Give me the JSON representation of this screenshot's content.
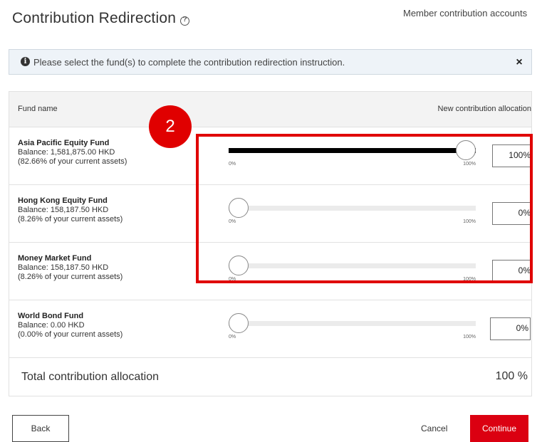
{
  "header": {
    "title": "Contribution Redirection",
    "top_link": "Member contribution accounts"
  },
  "notice": {
    "icon_glyph": "i",
    "text": "Please select the fund(s) to complete the contribution redirection instruction.",
    "close_glyph": "×"
  },
  "table": {
    "col_fund": "Fund name",
    "col_alloc": "New contribution allocation",
    "funds": [
      {
        "name": "Asia Pacific Equity Fund",
        "balance": "Balance: 1,581,875.00 HKD",
        "share": "(82.66% of your current assets)",
        "slider_min": "0%",
        "slider_max": "100%",
        "allocation": "100%",
        "allocation_value": 100
      },
      {
        "name": "Hong Kong Equity Fund",
        "balance": "Balance: 158,187.50 HKD",
        "share": "(8.26% of your current assets)",
        "slider_min": "0%",
        "slider_max": "100%",
        "allocation": "0%",
        "allocation_value": 0
      },
      {
        "name": "Money Market Fund",
        "balance": "Balance: 158,187.50 HKD",
        "share": "(8.26% of your current assets)",
        "slider_min": "0%",
        "slider_max": "100%",
        "allocation": "0%",
        "allocation_value": 0
      },
      {
        "name": "World Bond Fund",
        "balance": "Balance: 0.00 HKD",
        "share": "(0.00% of your current assets)",
        "slider_min": "0%",
        "slider_max": "100%",
        "allocation": "0%",
        "allocation_value": 0
      }
    ],
    "total_label": "Total contribution allocation",
    "total_value": "100 %"
  },
  "annotation": {
    "badge": "2",
    "color": "#e00000"
  },
  "footer": {
    "back": "Back",
    "cancel": "Cancel",
    "continue": "Continue"
  },
  "colors": {
    "primary": "#db0011",
    "notice_bg": "#eef3f8",
    "slider_fill": "#000000"
  }
}
